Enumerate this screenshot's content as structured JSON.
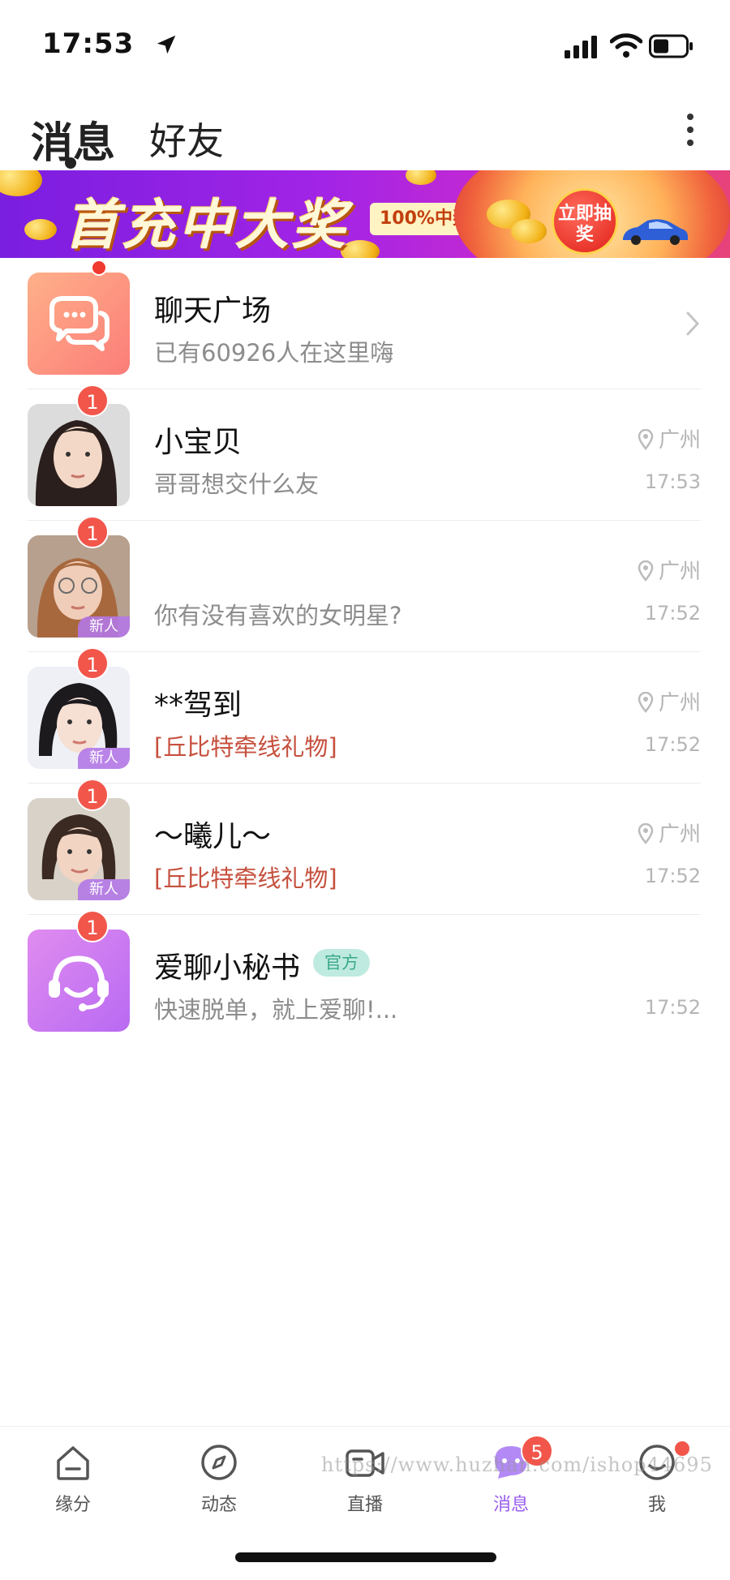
{
  "status_bar": {
    "time": "17:53"
  },
  "header": {
    "tabs": [
      {
        "label": "消息"
      },
      {
        "label": "好友"
      }
    ]
  },
  "banner": {
    "title": "首充中大奖",
    "tag": "100%中奖",
    "button": "立即抽奖"
  },
  "chat_plaza": {
    "name": "聊天广场",
    "subtitle": "已有60926人在这里嗨"
  },
  "conversations": [
    {
      "name": "小宝贝",
      "message": "哥哥想交什么友",
      "location": "广州",
      "time": "17:53",
      "unread": "1",
      "new_tag": ""
    },
    {
      "name": "",
      "message": "你有没有喜欢的女明星?",
      "location": "广州",
      "time": "17:52",
      "unread": "1",
      "new_tag": "新人"
    },
    {
      "name": "**驾到",
      "message": "[丘比特牵线礼物]",
      "location": "广州",
      "time": "17:52",
      "unread": "1",
      "new_tag": "新人"
    },
    {
      "name": "～曦儿～",
      "message": "[丘比特牵线礼物]",
      "location": "广州",
      "time": "17:52",
      "unread": "1",
      "new_tag": "新人"
    }
  ],
  "secretary": {
    "name": "爱聊小秘书",
    "official_tag": "官方",
    "message": "快速脱单，就上爱聊!...",
    "time": "17:52",
    "unread": "1"
  },
  "bottom_nav": {
    "items": [
      {
        "label": "缘分",
        "icon": "home-icon"
      },
      {
        "label": "动态",
        "icon": "compass-icon"
      },
      {
        "label": "直播",
        "icon": "video-icon"
      },
      {
        "label": "消息",
        "icon": "message-icon",
        "badge": "5"
      },
      {
        "label": "我",
        "icon": "profile-icon"
      }
    ]
  },
  "watermark": "https://www.huzhan.com/ishop44695",
  "colors": {
    "accent": "#9a5cf0",
    "badge": "#f2564b",
    "gift_text": "#c6503e"
  }
}
